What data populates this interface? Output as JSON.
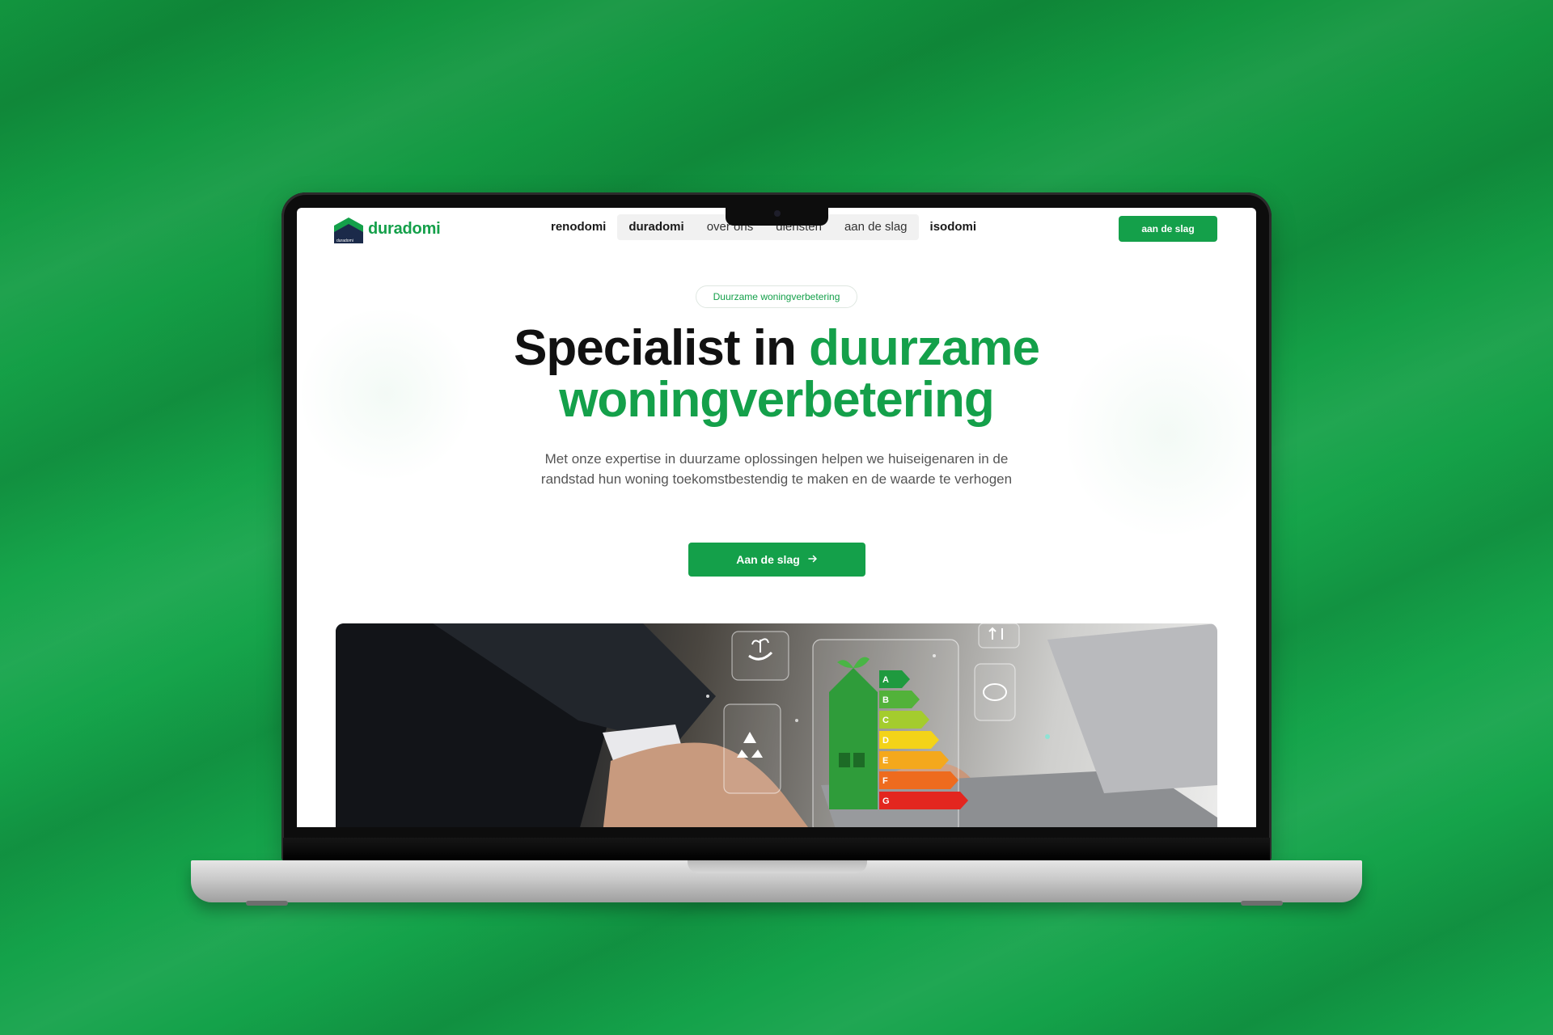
{
  "site": {
    "logo_text": "duradomi",
    "logo_sub": "duradomi"
  },
  "nav": {
    "links": [
      {
        "label": "renodomi"
      },
      {
        "label": "duradomi"
      },
      {
        "label": "over ons"
      },
      {
        "label": "diensten"
      },
      {
        "label": "aan de slag"
      },
      {
        "label": "isodomi"
      }
    ],
    "cta_label": "aan de slag"
  },
  "hero": {
    "badge": "Duurzame woningverbetering",
    "headline_dark": "Specialist in ",
    "headline_green_1": "duurzame",
    "headline_green_2": "woningverbetering",
    "subtitle": "Met onze expertise in duurzame oplossingen helpen we huiseigenaren in de randstad hun woning toekomstbestendig te maken en de waarde te verhogen",
    "cta_label": "Aan de slag",
    "cta_icon": "arrow-right-icon"
  },
  "energy_label": {
    "classes": [
      "A",
      "B",
      "C",
      "D",
      "E",
      "F",
      "G"
    ],
    "colors": [
      "#1f9a3f",
      "#52b23a",
      "#a4cc2e",
      "#f3d318",
      "#f4a81c",
      "#ee6b1e",
      "#e3261f"
    ]
  },
  "colors": {
    "brand_green": "#14a04a",
    "background_green": "#13a049",
    "text_dark": "#111111"
  }
}
